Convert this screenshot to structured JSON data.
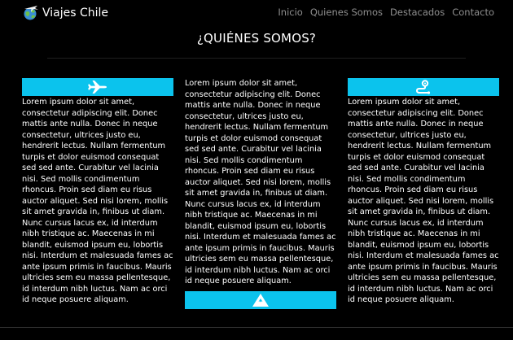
{
  "nav": {
    "brand": "Viajes Chile",
    "links": [
      "Inicio",
      "Quienes Somos",
      "Destacados",
      "Contacto"
    ]
  },
  "section": {
    "title": "¿QUIÉNES SOMOS?"
  },
  "columns": [
    {
      "icon": "airplane-icon",
      "text": "Lorem ipsum dolor sit amet, consectetur adipiscing elit. Donec mattis ante nulla. Donec in neque consectetur, ultrices justo eu, hendrerit lectus. Nullam fermentum turpis et dolor euismod consequat sed sed ante. Curabitur vel lacinia nisi. Sed mollis condimentum rhoncus. Proin sed diam eu risus auctor aliquet. Sed nisi lorem, mollis sit amet gravida in, finibus ut diam. Nunc cursus lacus ex, id interdum nibh tristique ac. Maecenas in mi blandit, euismod ipsum eu, lobortis nisi. Interdum et malesuada fames ac ante ipsum primis in faucibus. Mauris ultricies sem eu massa pellentesque, id interdum nibh luctus. Nam ac orci id neque posuere aliquam."
    },
    {
      "icon": "mountain-icon",
      "text": "Lorem ipsum dolor sit amet, consectetur adipiscing elit. Donec mattis ante nulla. Donec in neque consectetur, ultrices justo eu, hendrerit lectus. Nullam fermentum turpis et dolor euismod consequat sed sed ante. Curabitur vel lacinia nisi. Sed mollis condimentum rhoncus. Proin sed diam eu risus auctor aliquet. Sed nisi lorem, mollis sit amet gravida in, finibus ut diam. Nunc cursus lacus ex, id interdum nibh tristique ac. Maecenas in mi blandit, euismod ipsum eu, lobortis nisi. Interdum et malesuada fames ac ante ipsum primis in faucibus. Mauris ultricies sem eu massa pellentesque, id interdum nibh luctus. Nam ac orci id neque posuere aliquam."
    },
    {
      "icon": "route-icon",
      "text": "Lorem ipsum dolor sit amet, consectetur adipiscing elit. Donec mattis ante nulla. Donec in neque consectetur, ultrices justo eu, hendrerit lectus. Nullam fermentum turpis et dolor euismod consequat sed sed ante. Curabitur vel lacinia nisi. Sed mollis condimentum rhoncus. Proin sed diam eu risus auctor aliquet. Sed nisi lorem, mollis sit amet gravida in, finibus ut diam. Nunc cursus lacus ex, id interdum nibh tristique ac. Maecenas in mi blandit, euismod ipsum eu, lobortis nisi. Interdum et malesuada fames ac ante ipsum primis in faucibus. Mauris ultricies sem eu massa pellentesque, id interdum nibh luctus. Nam ac orci id neque posuere aliquam."
    }
  ],
  "colors": {
    "background": "#000000",
    "accent": "#0bc3ed",
    "nav_link": "#8f8f8f",
    "text": "#ffffff"
  }
}
